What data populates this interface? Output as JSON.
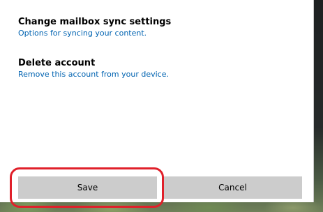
{
  "options": [
    {
      "title": "Change mailbox sync settings",
      "link": "Options for syncing your content."
    },
    {
      "title": "Delete account",
      "link": "Remove this account from your device."
    }
  ],
  "buttons": {
    "save_label": "Save",
    "cancel_label": "Cancel"
  },
  "colors": {
    "link": "#0063b1",
    "button_bg": "#cccccc",
    "highlight": "#e0202a"
  }
}
